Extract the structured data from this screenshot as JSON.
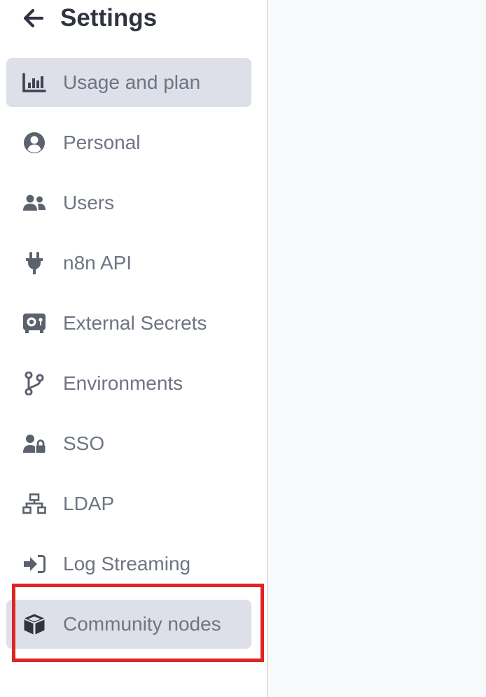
{
  "header": {
    "title": "Settings",
    "back_icon": "arrow-left-icon"
  },
  "sidebar": {
    "items": [
      {
        "label": "Usage and plan",
        "icon": "chart-bar-icon",
        "active": true
      },
      {
        "label": "Personal",
        "icon": "user-circle-icon",
        "active": false
      },
      {
        "label": "Users",
        "icon": "user-friends-icon",
        "active": false
      },
      {
        "label": "n8n API",
        "icon": "plug-icon",
        "active": false
      },
      {
        "label": "External Secrets",
        "icon": "vault-icon",
        "active": false
      },
      {
        "label": "Environments",
        "icon": "code-branch-icon",
        "active": false
      },
      {
        "label": "SSO",
        "icon": "user-lock-icon",
        "active": false
      },
      {
        "label": "LDAP",
        "icon": "network-wired-icon",
        "active": false
      },
      {
        "label": "Log Streaming",
        "icon": "sign-in-icon",
        "active": false
      },
      {
        "label": "Community nodes",
        "icon": "cube-icon",
        "active": true
      }
    ]
  },
  "colors": {
    "icon": "#5c616e",
    "label": "#6f7483",
    "title": "#2f3440",
    "active_bg": "#dde0e8",
    "highlight": "#e02424",
    "main_bg": "#f8f9fb"
  }
}
